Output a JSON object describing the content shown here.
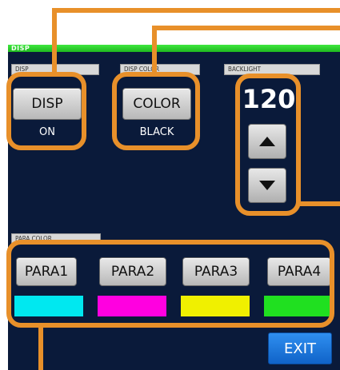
{
  "title_bar": {
    "label": "DISP"
  },
  "display_section": {
    "tab_label": "DISP",
    "button_label": "DISP",
    "status": "ON"
  },
  "color_section": {
    "tab_label": "DISP COLOR",
    "button_label": "COLOR",
    "status": "BLACK"
  },
  "brightness_section": {
    "tab_label": "BACKLIGHT",
    "value": "120",
    "up_icon": "up-arrow-icon",
    "down_icon": "down-arrow-icon"
  },
  "param_color_section": {
    "tab_label": "PARA COLOR",
    "params": [
      {
        "label": "PARA1",
        "color": "#00e8f0"
      },
      {
        "label": "PARA2",
        "color": "#ff00e0"
      },
      {
        "label": "PARA3",
        "color": "#f0f000"
      },
      {
        "label": "PARA4",
        "color": "#20e020"
      }
    ]
  },
  "exit_button": {
    "label": "EXIT"
  },
  "callout_color": "#e8902a"
}
